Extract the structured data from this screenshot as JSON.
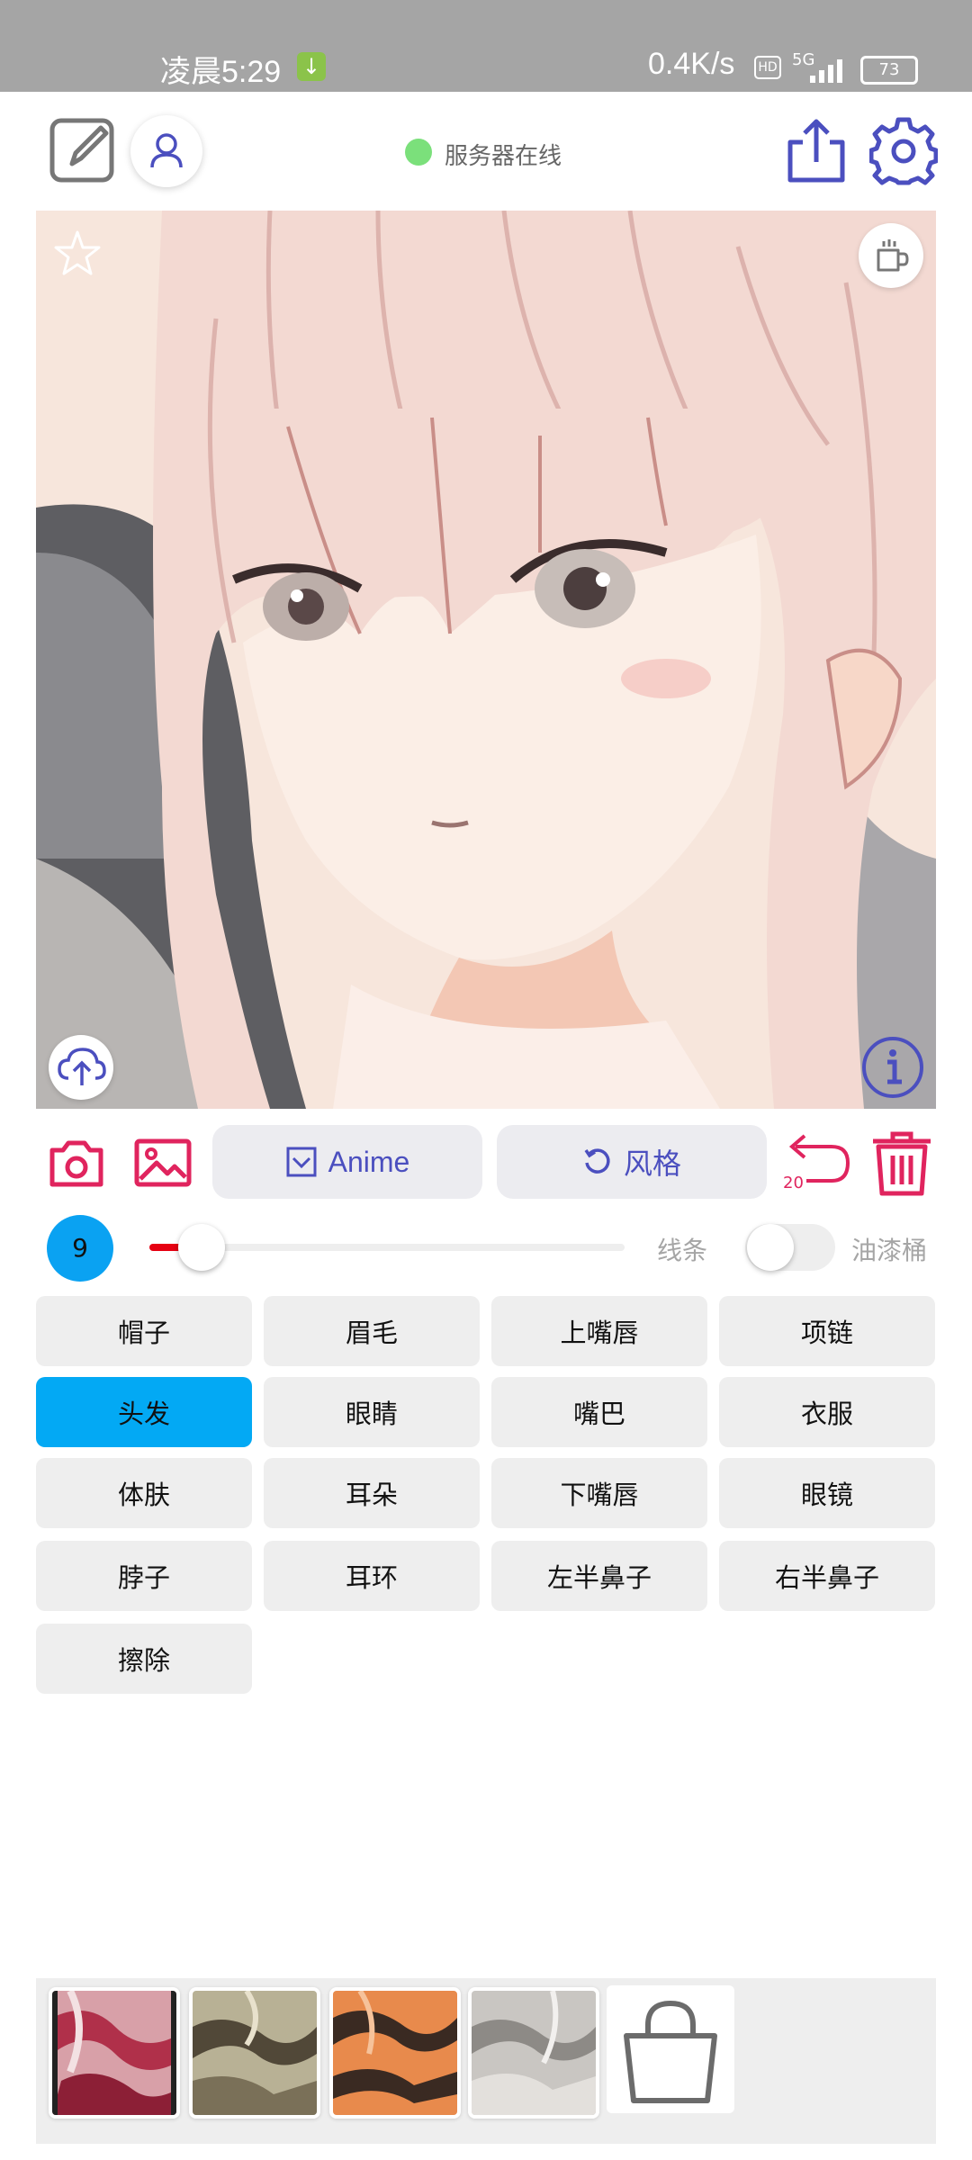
{
  "status_bar": {
    "time": "凌晨5:29",
    "net_speed": "0.4K/s",
    "hd": "HD",
    "network": "5G",
    "battery": "73"
  },
  "header": {
    "server_status": "服务器在线"
  },
  "toolbar": {
    "anime_label": "Anime",
    "style_label": "风格",
    "undo_count": "20"
  },
  "brush": {
    "size": "9",
    "slider_value": 0.05,
    "line_label": "线条",
    "bucket_label": "油漆桶",
    "bucket_enabled": false
  },
  "parts": [
    {
      "label": "帽子"
    },
    {
      "label": "眉毛"
    },
    {
      "label": "上嘴唇"
    },
    {
      "label": "项链"
    },
    {
      "label": "头发"
    },
    {
      "label": "眼睛"
    },
    {
      "label": "嘴巴"
    },
    {
      "label": "衣服"
    },
    {
      "label": "体肤"
    },
    {
      "label": "耳朵"
    },
    {
      "label": "下嘴唇"
    },
    {
      "label": "眼镜"
    },
    {
      "label": "脖子"
    },
    {
      "label": "耳环"
    },
    {
      "label": "左半鼻子"
    },
    {
      "label": "右半鼻子"
    },
    {
      "label": "擦除"
    }
  ],
  "selected_part": "头发",
  "colors": {
    "accent_blue": "#4b4fbf",
    "accent_pink": "#e0245e",
    "selected": "#03a9f4",
    "online": "#7be07b"
  }
}
